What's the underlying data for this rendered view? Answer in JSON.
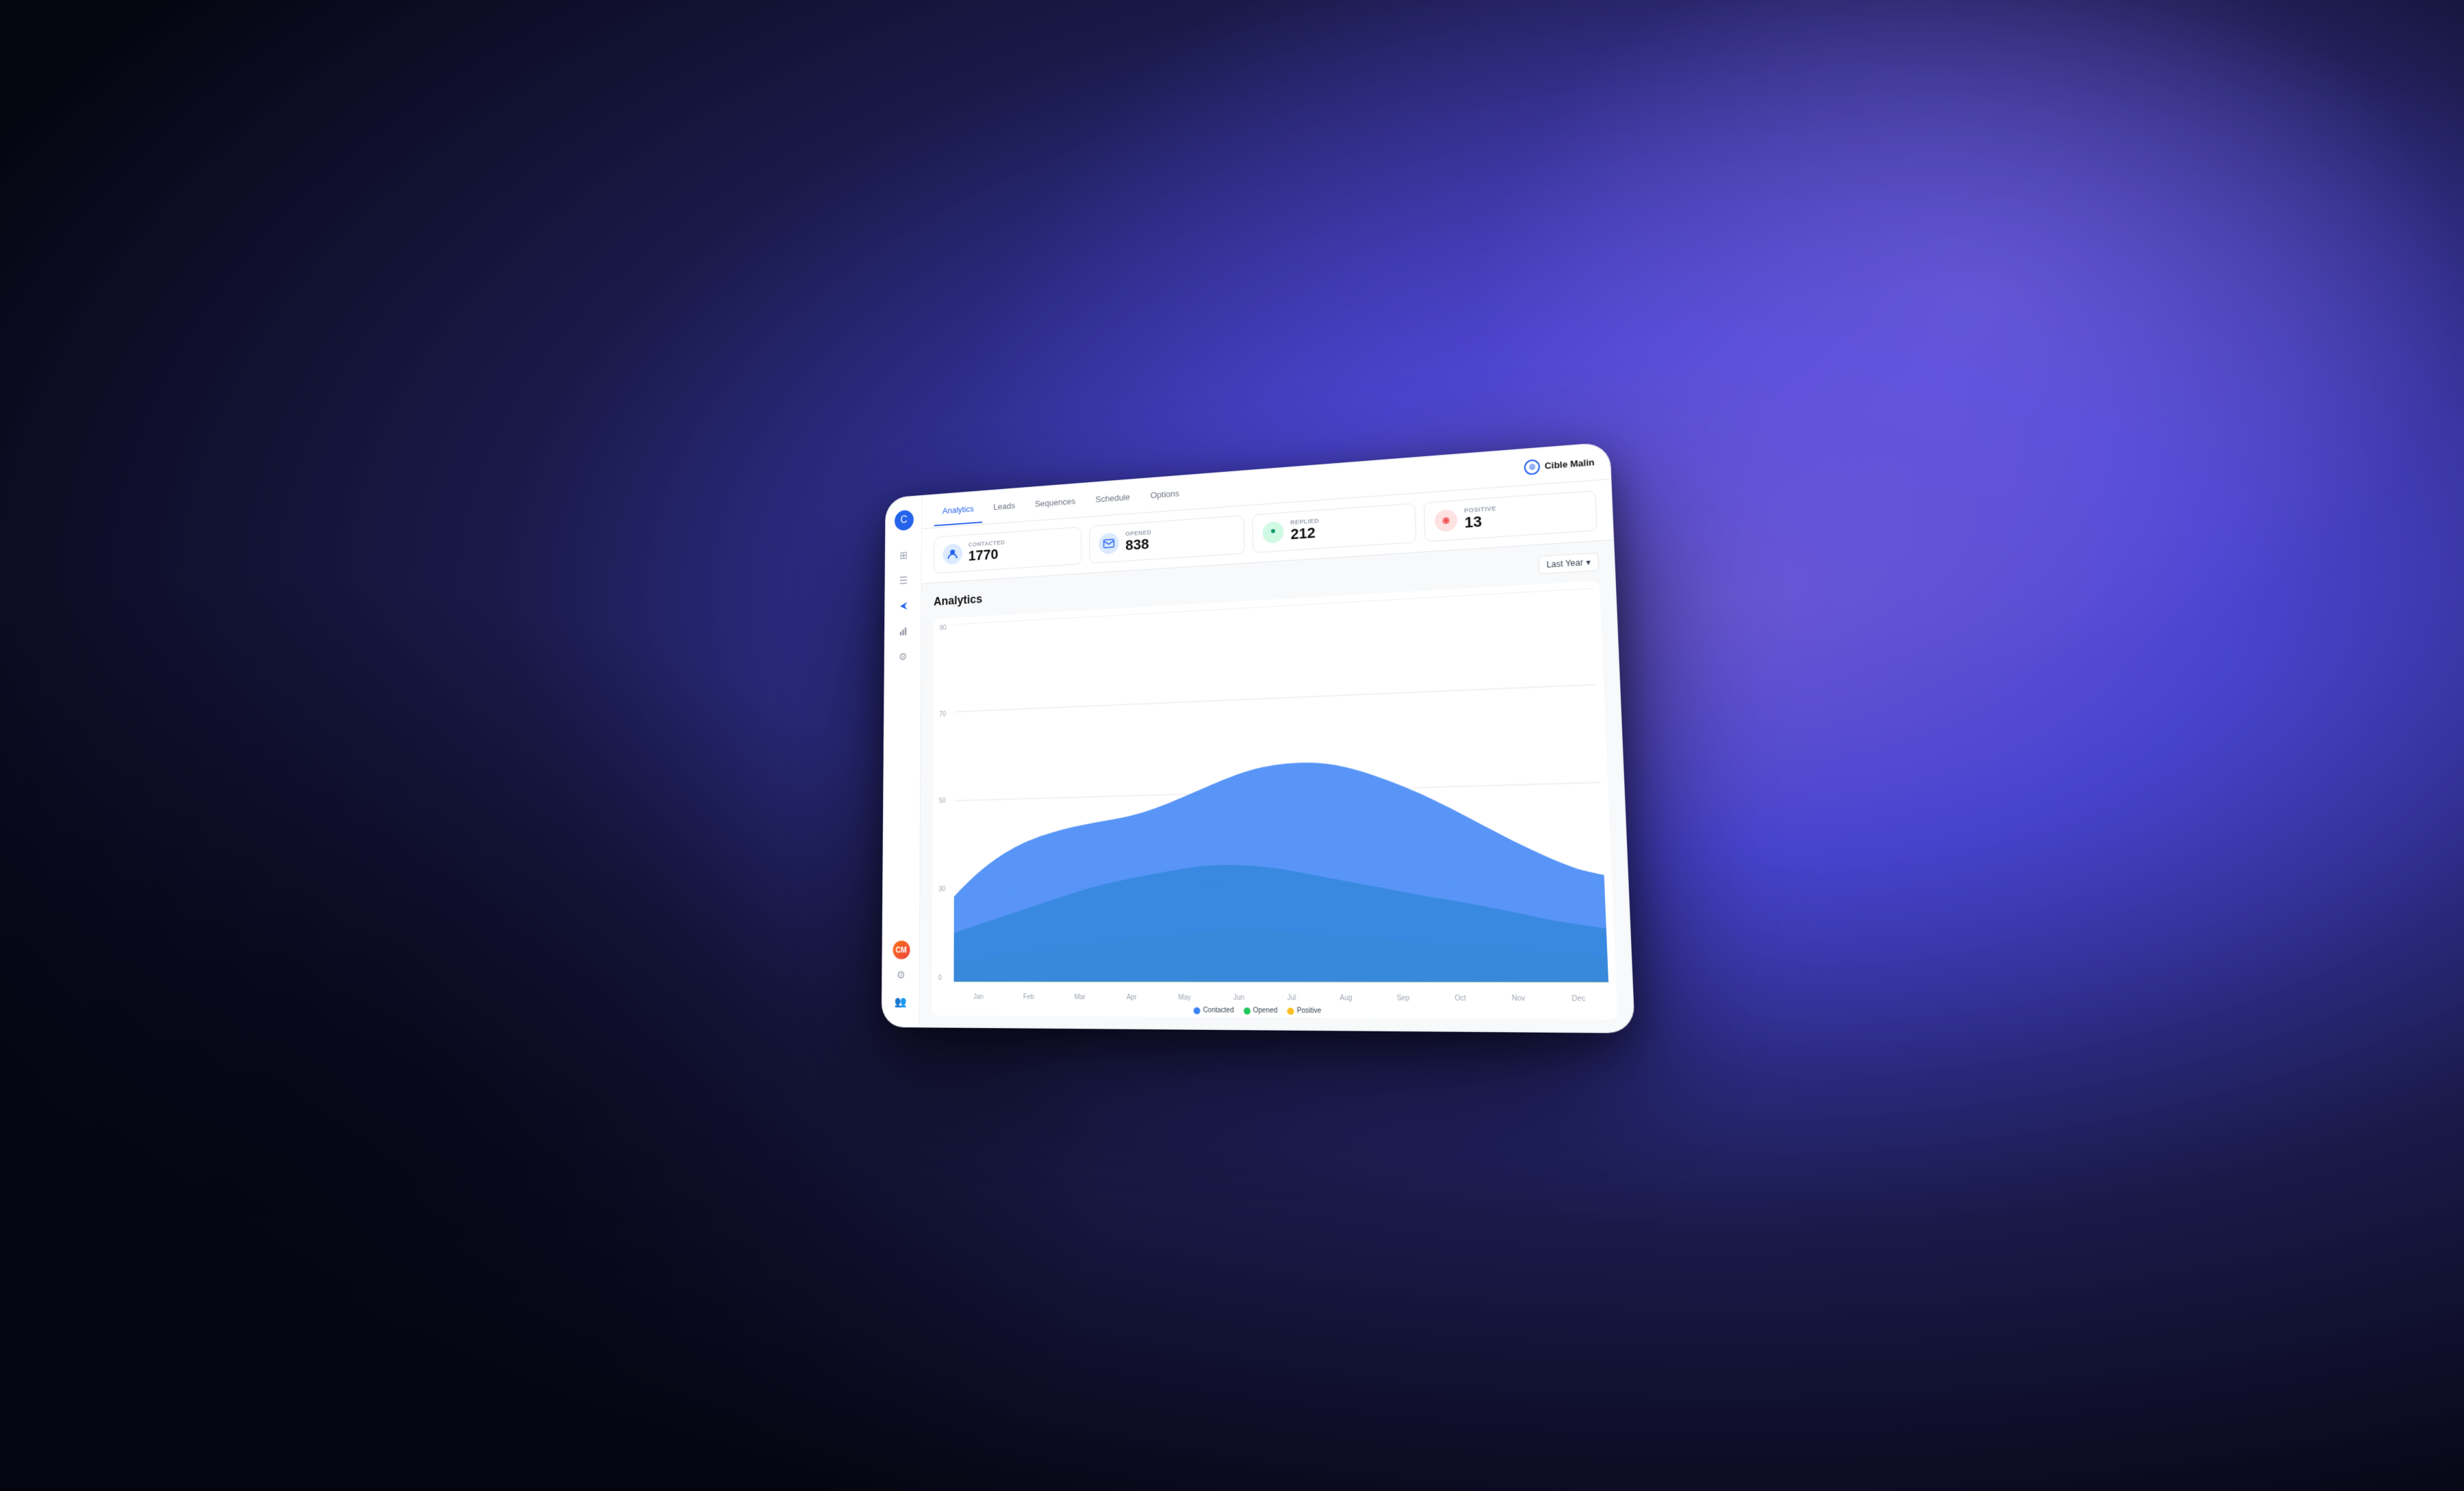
{
  "background": {
    "gradient_description": "dark left, purple/blue right radial gradient"
  },
  "sidebar": {
    "logo_icon": "C",
    "icons": [
      {
        "name": "home-icon",
        "symbol": "⊞",
        "active": false
      },
      {
        "name": "list-icon",
        "symbol": "☰",
        "active": false
      },
      {
        "name": "send-icon",
        "symbol": "➤",
        "active": true
      },
      {
        "name": "chart-icon",
        "symbol": "◈",
        "active": false
      },
      {
        "name": "settings-icon",
        "symbol": "⚙",
        "active": false
      }
    ],
    "bottom_icons": [
      {
        "name": "settings-bottom-icon",
        "symbol": "⚙"
      },
      {
        "name": "users-icon",
        "symbol": "👥"
      }
    ],
    "avatar_initials": "CM"
  },
  "tabs": [
    {
      "label": "Analytics",
      "active": true
    },
    {
      "label": "Leads",
      "active": false
    },
    {
      "label": "Sequences",
      "active": false
    },
    {
      "label": "Schedule",
      "active": false
    },
    {
      "label": "Options",
      "active": false
    }
  ],
  "brand": {
    "name": "Cible Malin",
    "icon_symbol": "◎"
  },
  "stats": [
    {
      "id": "contacted",
      "label": "CONTACTED",
      "value": "1770",
      "icon": "👤",
      "icon_type": "contacted"
    },
    {
      "id": "opened",
      "label": "OPENED",
      "value": "838",
      "icon": "✉",
      "icon_type": "opened"
    },
    {
      "id": "replied",
      "label": "REPLIED",
      "value": "212",
      "icon": "💬",
      "icon_type": "replied"
    },
    {
      "id": "positive",
      "label": "POSITIVE",
      "value": "13",
      "icon": "◎",
      "icon_type": "positive"
    }
  ],
  "analytics": {
    "title": "Analytics",
    "period_selector": "Last Year",
    "y_axis_labels": [
      "90",
      "70",
      "50",
      "30",
      "0"
    ],
    "x_axis_labels": [
      "Jan",
      "Feb",
      "Mar",
      "Apr",
      "May",
      "Jun",
      "Jul",
      "Aug",
      "Sep",
      "Oct",
      "Nov",
      "Dec"
    ],
    "legend": [
      {
        "label": "Contacted",
        "color": "#3b82f6"
      },
      {
        "label": "Opened",
        "color": "#22c55e"
      },
      {
        "label": "Positive",
        "color": "#fbbf24"
      }
    ],
    "chart_colors": {
      "contacted": "#3b82f6",
      "opened": "#16a34a",
      "positive": "#fbbf24"
    }
  }
}
